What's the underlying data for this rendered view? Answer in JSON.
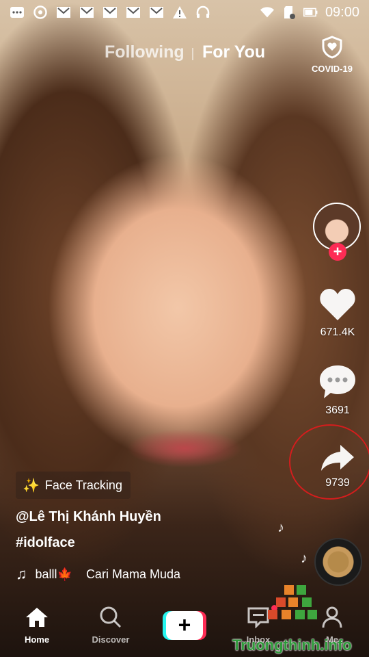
{
  "status_bar": {
    "time": "09:00",
    "left_icons": [
      "notification-icon",
      "chrome-icon",
      "gmail-icon",
      "gmail-icon",
      "gmail-icon",
      "gmail-icon",
      "gmail-icon",
      "warning-icon",
      "headset-icon"
    ],
    "right_icons": [
      "wifi-icon",
      "sd-card-icon",
      "battery-icon"
    ]
  },
  "top_nav": {
    "following": "Following",
    "for_you": "For You",
    "covid_label": "COVID-19"
  },
  "right_rail": {
    "likes": "671.4K",
    "comments": "3691",
    "shares": "9739",
    "follow_symbol": "+"
  },
  "caption": {
    "effect": "Face Tracking",
    "username": "@Lê Thị Khánh Huyền",
    "hashtag": "#idolface",
    "music_left": "balll🍁",
    "music_right": "Cari Mama Muda"
  },
  "bottom_nav": {
    "home": "Home",
    "discover": "Discover",
    "create": "+",
    "inbox": "Inbox",
    "me": "Me"
  },
  "watermark": "Truongthinh.info",
  "colors": {
    "accent": "#fe2c55",
    "cyan": "#25f4ee",
    "annotation": "#d41d1d"
  }
}
